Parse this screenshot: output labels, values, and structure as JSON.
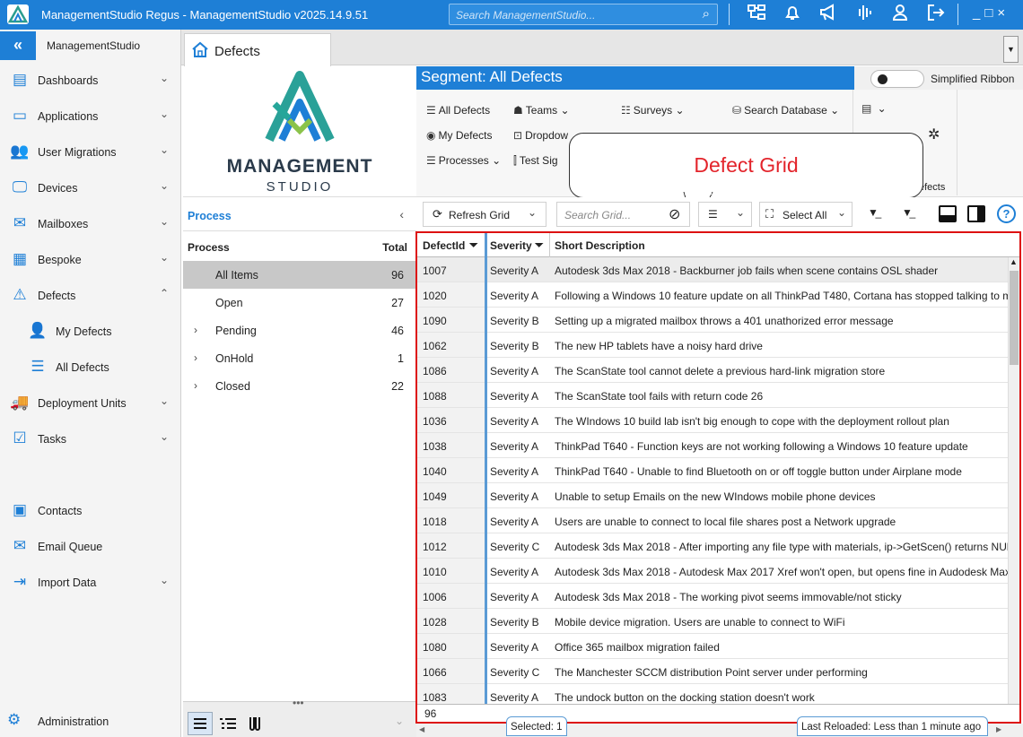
{
  "app": {
    "title": "ManagementStudio Regus - ManagementStudio v2025.14.9.51",
    "search_placeholder": "Search ManagementStudio...",
    "window_controls": [
      "_",
      "□",
      "×"
    ],
    "accent": "#1e7fd6"
  },
  "sidebar": {
    "app_name": "ManagementStudio",
    "items": [
      {
        "label": "Dashboards",
        "icon": "dashboard-icon",
        "chevron": "⌄"
      },
      {
        "label": "Applications",
        "icon": "applications-icon",
        "chevron": "⌄"
      },
      {
        "label": "User Migrations",
        "icon": "users-icon",
        "chevron": "⌄"
      },
      {
        "label": "Devices",
        "icon": "monitor-icon",
        "chevron": "⌄"
      },
      {
        "label": "Mailboxes",
        "icon": "mailbox-icon",
        "chevron": "⌄"
      },
      {
        "label": "Bespoke",
        "icon": "cubes-icon",
        "chevron": "⌄"
      },
      {
        "label": "Defects",
        "icon": "warning-icon",
        "chevron": "⌃"
      },
      {
        "label": "My Defects",
        "icon": "user-check-icon",
        "chevron": ""
      },
      {
        "label": "All Defects",
        "icon": "list-icon",
        "chevron": ""
      },
      {
        "label": "Deployment Units",
        "icon": "truck-icon",
        "chevron": "⌄"
      },
      {
        "label": "Tasks",
        "icon": "tasks-icon",
        "chevron": "⌄"
      },
      {
        "label": "Contacts",
        "icon": "contacts-icon",
        "chevron": ""
      },
      {
        "label": "Email Queue",
        "icon": "email-queue-icon",
        "chevron": ""
      },
      {
        "label": "Import Data",
        "icon": "import-icon",
        "chevron": "⌄"
      }
    ],
    "admin_label": "Administration"
  },
  "tab": {
    "label": "Defects"
  },
  "logo": {
    "line1": "MANAGEMENT",
    "line2": "STUDIO"
  },
  "process": {
    "header": "Process",
    "col_process": "Process",
    "col_total": "Total",
    "rows": [
      {
        "label": "All Items",
        "count": "96",
        "expander": ""
      },
      {
        "label": "Open",
        "count": "27",
        "expander": ""
      },
      {
        "label": "Pending",
        "count": "46",
        "expander": "›"
      },
      {
        "label": "OnHold",
        "count": "1",
        "expander": "›"
      },
      {
        "label": "Closed",
        "count": "22",
        "expander": "›"
      }
    ]
  },
  "ribbon": {
    "segment_title": "Segment: All Defects",
    "simplified_label": "Simplified Ribbon",
    "buttons": {
      "all_defects": "All Defects",
      "my_defects": "My Defects",
      "processes": "Processes",
      "teams": "Teams",
      "dropdown": "Dropdow",
      "test_sig": "Test Sig",
      "surveys": "Surveys",
      "search_db": "Search Database",
      "group_label": "efects"
    }
  },
  "callout": {
    "text": "Defect Grid"
  },
  "toolbar": {
    "refresh": "Refresh Grid",
    "search_placeholder": "Search Grid...",
    "select_all": "Select All"
  },
  "grid": {
    "columns": [
      "DefectId",
      "Severity",
      "Short Description"
    ],
    "rows": [
      {
        "id": "1007",
        "sev": "Severity A",
        "desc": "Autodesk 3ds Max 2018 - Backburner job fails when scene contains OSL shader"
      },
      {
        "id": "1020",
        "sev": "Severity A",
        "desc": "Following a Windows 10 feature update on all ThinkPad T480, Cortana has stopped talking to m"
      },
      {
        "id": "1090",
        "sev": "Severity B",
        "desc": "Setting up a migrated mailbox throws a 401 unathorized error message"
      },
      {
        "id": "1062",
        "sev": "Severity B",
        "desc": "The new HP tablets have a noisy hard drive"
      },
      {
        "id": "1086",
        "sev": "Severity A",
        "desc": "The ScanState tool cannot delete a previous hard-link migration store"
      },
      {
        "id": "1088",
        "sev": "Severity A",
        "desc": "The ScanState tool fails with return code 26"
      },
      {
        "id": "1036",
        "sev": "Severity A",
        "desc": "The WIndows 10 build lab isn't big enough to cope with the deployment rollout plan"
      },
      {
        "id": "1038",
        "sev": "Severity A",
        "desc": "ThinkPad T640 - Function keys are not working following a Windows 10 feature update"
      },
      {
        "id": "1040",
        "sev": "Severity A",
        "desc": "ThinkPad T640 - Unable to find Bluetooth on or off toggle button under Airplane mode"
      },
      {
        "id": "1049",
        "sev": "Severity A",
        "desc": "Unable to setup Emails on the new WIndows mobile phone devices"
      },
      {
        "id": "1018",
        "sev": "Severity A",
        "desc": "Users are unable to connect to local file shares post a Network upgrade"
      },
      {
        "id": "1012",
        "sev": "Severity C",
        "desc": "Autodesk 3ds Max 2018 - After importing any file type with materials, ip->GetScen() returns NUl"
      },
      {
        "id": "1010",
        "sev": "Severity A",
        "desc": "Autodesk 3ds Max 2018 - Autodesk Max 2017 Xref won't open, but opens fine in Audodesk Max"
      },
      {
        "id": "1006",
        "sev": "Severity A",
        "desc": "Autodesk 3ds Max 2018 - The working pivot seems immovable/not sticky"
      },
      {
        "id": "1028",
        "sev": "Severity B",
        "desc": "Mobile device migration. Users are unable to connect to WiFi"
      },
      {
        "id": "1080",
        "sev": "Severity A",
        "desc": "Office 365 mailbox migration failed"
      },
      {
        "id": "1066",
        "sev": "Severity C",
        "desc": "The Manchester SCCM distribution Point server under performing"
      },
      {
        "id": "1083",
        "sev": "Severity A",
        "desc": "The undock button on the docking station doesn't work"
      }
    ],
    "footer_count": "96"
  },
  "status": {
    "selected": "Selected: 1",
    "last_reloaded": "Last Reloaded: Less than 1 minute ago"
  }
}
